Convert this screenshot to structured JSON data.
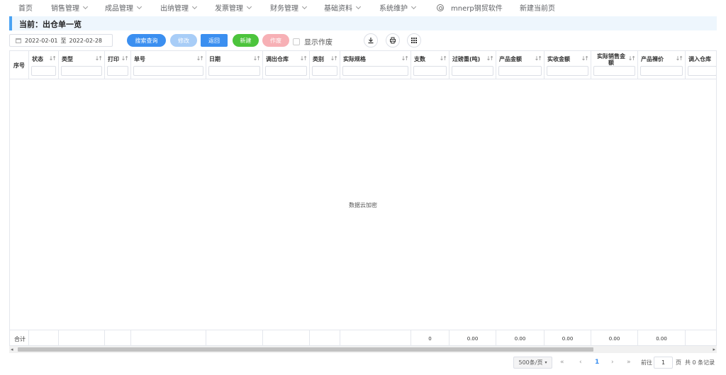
{
  "nav": {
    "items": [
      {
        "label": "首页",
        "dropdown": false
      },
      {
        "label": "销售管理",
        "dropdown": true
      },
      {
        "label": "成品管理",
        "dropdown": true
      },
      {
        "label": "出纳管理",
        "dropdown": true
      },
      {
        "label": "发票管理",
        "dropdown": true
      },
      {
        "label": "财务管理",
        "dropdown": true
      },
      {
        "label": "基础资料",
        "dropdown": true
      },
      {
        "label": "系统维护",
        "dropdown": true
      }
    ],
    "brand": "mnerp钢贸软件",
    "new_home": "新建当前页"
  },
  "breadcrumb": "当前：出仓单一览",
  "toolbar": {
    "date_start": "2022-02-01",
    "date_sep": "至",
    "date_end": "2022-02-28",
    "search": "搜索查询",
    "edit": "修改",
    "back": "返回",
    "new": "新建",
    "void": "作废",
    "show_void": "显示作废"
  },
  "table": {
    "columns": [
      {
        "label": "序号"
      },
      {
        "label": "状态"
      },
      {
        "label": "类型"
      },
      {
        "label": "打印"
      },
      {
        "label": "单号"
      },
      {
        "label": "日期"
      },
      {
        "label": "调出仓库"
      },
      {
        "label": "类别"
      },
      {
        "label": "实际规格"
      },
      {
        "label": "支数"
      },
      {
        "label": "过磅重(吨)"
      },
      {
        "label": "产品金额"
      },
      {
        "label": "实收金额"
      },
      {
        "label": "实际销售金额"
      },
      {
        "label": "产品裸价"
      },
      {
        "label": "调入仓库"
      }
    ],
    "empty_text": "数据云加密",
    "footer": [
      "合计",
      "",
      "",
      "",
      "",
      "",
      "",
      "",
      "",
      "0",
      "0.00",
      "0.00",
      "0.00",
      "0.00",
      "0.00",
      ""
    ]
  },
  "pager": {
    "page_size": "500条/页",
    "first": "«",
    "prev": "‹",
    "current": "1",
    "next": "›",
    "last": "»",
    "goto": "前往",
    "page_input": "1",
    "page_unit": "页",
    "total": "共 0 条记录"
  }
}
